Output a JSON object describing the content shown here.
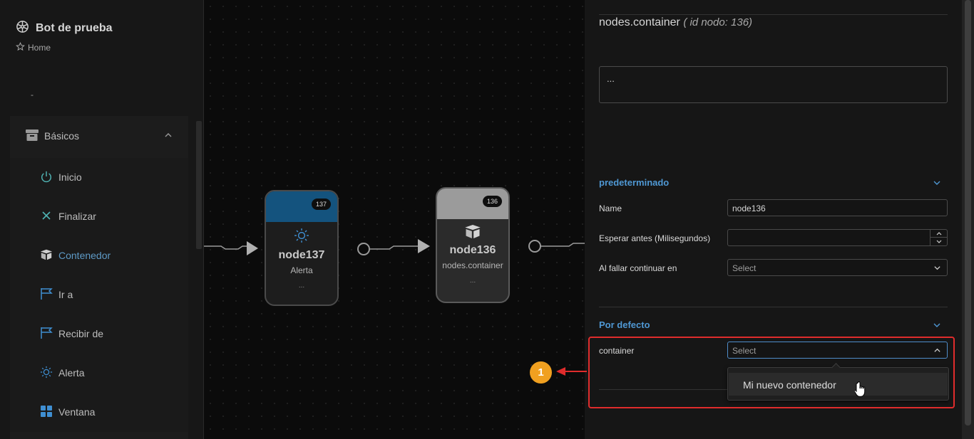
{
  "sidebar": {
    "title": "Bot de prueba",
    "breadcrumb": "Home",
    "divider_text": "-",
    "group": {
      "label": "Básicos",
      "expanded": true
    },
    "items": [
      {
        "label": "Inicio",
        "icon": "power-icon",
        "active": false
      },
      {
        "label": "Finalizar",
        "icon": "close-icon",
        "active": false
      },
      {
        "label": "Contenedor",
        "icon": "box-icon",
        "active": true
      },
      {
        "label": "Ir a",
        "icon": "flag-icon",
        "active": false
      },
      {
        "label": "Recibir de",
        "icon": "flag-icon",
        "active": false
      },
      {
        "label": "Alerta",
        "icon": "sun-icon",
        "active": false
      },
      {
        "label": "Ventana",
        "icon": "grid-icon",
        "active": false
      }
    ]
  },
  "canvas": {
    "nodes": [
      {
        "id": "137",
        "name": "node137",
        "type": "Alerta",
        "dots": "...",
        "header_color": "#14537e",
        "icon": "sun-icon"
      },
      {
        "id": "136",
        "name": "node136",
        "type": "nodes.container",
        "dots": "...",
        "header_color": "#9b9b9b",
        "icon": "box-icon"
      }
    ]
  },
  "panel": {
    "title_main": "nodes.container",
    "title_id": "( id nodo: 136)",
    "description": "...",
    "section1": {
      "title": "predeterminado",
      "fields": {
        "name_label": "Name",
        "name_value": "node136",
        "wait_label": "Esperar antes (Milisegundos)",
        "wait_value": "",
        "onfail_label": "Al fallar continuar en",
        "onfail_placeholder": "Select"
      }
    },
    "section2": {
      "title": "Por defecto",
      "container_label": "container",
      "container_placeholder": "Select",
      "dropdown_option": "Mi nuevo contenedor"
    }
  },
  "annotation": {
    "callout_number": "1",
    "color": "#e02c2c",
    "badge_color": "#f0a020"
  },
  "colors": {
    "accent": "#4f98d4",
    "active_item": "#5e9ac6"
  }
}
